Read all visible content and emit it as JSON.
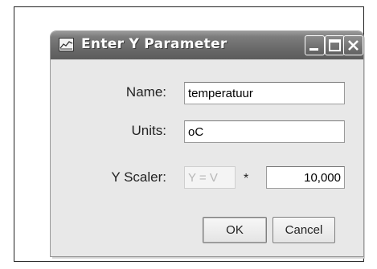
{
  "dialog": {
    "title": "Enter Y Parameter",
    "app_icon": "chart-window-icon",
    "controls": {
      "minimize_icon": "minimize-icon",
      "maximize_icon": "maximize-icon",
      "close_icon": "close-icon"
    }
  },
  "form": {
    "name_label": "Name:",
    "name_value": "temperatuur",
    "units_label": "Units:",
    "units_value": "oC",
    "scaler_label": "Y Scaler:",
    "scaler_expr": "Y = V",
    "scaler_operator": "*",
    "scaler_value": "10,000"
  },
  "buttons": {
    "ok_label": "OK",
    "cancel_label": "Cancel"
  },
  "colors": {
    "titlebar": "#6a6a6a",
    "dialog_bg": "#e8e8e8"
  }
}
